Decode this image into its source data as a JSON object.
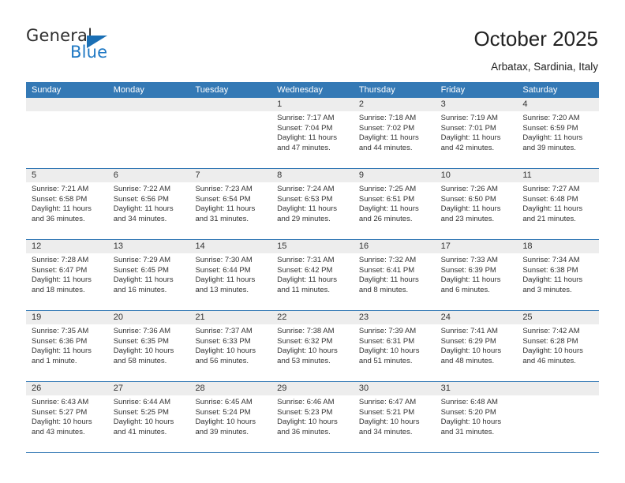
{
  "brand": {
    "name_top": "General",
    "name_bottom": "Blue",
    "triangle_color": "#1a6fb5",
    "blue_text_color": "#2079c4"
  },
  "header": {
    "title": "October 2025",
    "subtitle": "Arbatax, Sardinia, Italy"
  },
  "theme": {
    "header_blue": "#3479b5",
    "daynum_band": "#ededed",
    "cell_background": "#ffffff",
    "text": "#333333"
  },
  "calendar": {
    "weekday_headers": [
      "Sunday",
      "Monday",
      "Tuesday",
      "Wednesday",
      "Thursday",
      "Friday",
      "Saturday"
    ],
    "labels": {
      "sunrise": "Sunrise:",
      "sunset": "Sunset:",
      "daylight": "Daylight:"
    },
    "weeks": [
      [
        {
          "day": "",
          "empty": true
        },
        {
          "day": "",
          "empty": true
        },
        {
          "day": "",
          "empty": true
        },
        {
          "day": "1",
          "sunrise": "Sunrise: 7:17 AM",
          "sunset": "Sunset: 7:04 PM",
          "daylight_line1": "Daylight: 11 hours",
          "daylight_line2": "and 47 minutes."
        },
        {
          "day": "2",
          "sunrise": "Sunrise: 7:18 AM",
          "sunset": "Sunset: 7:02 PM",
          "daylight_line1": "Daylight: 11 hours",
          "daylight_line2": "and 44 minutes."
        },
        {
          "day": "3",
          "sunrise": "Sunrise: 7:19 AM",
          "sunset": "Sunset: 7:01 PM",
          "daylight_line1": "Daylight: 11 hours",
          "daylight_line2": "and 42 minutes."
        },
        {
          "day": "4",
          "sunrise": "Sunrise: 7:20 AM",
          "sunset": "Sunset: 6:59 PM",
          "daylight_line1": "Daylight: 11 hours",
          "daylight_line2": "and 39 minutes."
        }
      ],
      [
        {
          "day": "5",
          "sunrise": "Sunrise: 7:21 AM",
          "sunset": "Sunset: 6:58 PM",
          "daylight_line1": "Daylight: 11 hours",
          "daylight_line2": "and 36 minutes."
        },
        {
          "day": "6",
          "sunrise": "Sunrise: 7:22 AM",
          "sunset": "Sunset: 6:56 PM",
          "daylight_line1": "Daylight: 11 hours",
          "daylight_line2": "and 34 minutes."
        },
        {
          "day": "7",
          "sunrise": "Sunrise: 7:23 AM",
          "sunset": "Sunset: 6:54 PM",
          "daylight_line1": "Daylight: 11 hours",
          "daylight_line2": "and 31 minutes."
        },
        {
          "day": "8",
          "sunrise": "Sunrise: 7:24 AM",
          "sunset": "Sunset: 6:53 PM",
          "daylight_line1": "Daylight: 11 hours",
          "daylight_line2": "and 29 minutes."
        },
        {
          "day": "9",
          "sunrise": "Sunrise: 7:25 AM",
          "sunset": "Sunset: 6:51 PM",
          "daylight_line1": "Daylight: 11 hours",
          "daylight_line2": "and 26 minutes."
        },
        {
          "day": "10",
          "sunrise": "Sunrise: 7:26 AM",
          "sunset": "Sunset: 6:50 PM",
          "daylight_line1": "Daylight: 11 hours",
          "daylight_line2": "and 23 minutes."
        },
        {
          "day": "11",
          "sunrise": "Sunrise: 7:27 AM",
          "sunset": "Sunset: 6:48 PM",
          "daylight_line1": "Daylight: 11 hours",
          "daylight_line2": "and 21 minutes."
        }
      ],
      [
        {
          "day": "12",
          "sunrise": "Sunrise: 7:28 AM",
          "sunset": "Sunset: 6:47 PM",
          "daylight_line1": "Daylight: 11 hours",
          "daylight_line2": "and 18 minutes."
        },
        {
          "day": "13",
          "sunrise": "Sunrise: 7:29 AM",
          "sunset": "Sunset: 6:45 PM",
          "daylight_line1": "Daylight: 11 hours",
          "daylight_line2": "and 16 minutes."
        },
        {
          "day": "14",
          "sunrise": "Sunrise: 7:30 AM",
          "sunset": "Sunset: 6:44 PM",
          "daylight_line1": "Daylight: 11 hours",
          "daylight_line2": "and 13 minutes."
        },
        {
          "day": "15",
          "sunrise": "Sunrise: 7:31 AM",
          "sunset": "Sunset: 6:42 PM",
          "daylight_line1": "Daylight: 11 hours",
          "daylight_line2": "and 11 minutes."
        },
        {
          "day": "16",
          "sunrise": "Sunrise: 7:32 AM",
          "sunset": "Sunset: 6:41 PM",
          "daylight_line1": "Daylight: 11 hours",
          "daylight_line2": "and 8 minutes."
        },
        {
          "day": "17",
          "sunrise": "Sunrise: 7:33 AM",
          "sunset": "Sunset: 6:39 PM",
          "daylight_line1": "Daylight: 11 hours",
          "daylight_line2": "and 6 minutes."
        },
        {
          "day": "18",
          "sunrise": "Sunrise: 7:34 AM",
          "sunset": "Sunset: 6:38 PM",
          "daylight_line1": "Daylight: 11 hours",
          "daylight_line2": "and 3 minutes."
        }
      ],
      [
        {
          "day": "19",
          "sunrise": "Sunrise: 7:35 AM",
          "sunset": "Sunset: 6:36 PM",
          "daylight_line1": "Daylight: 11 hours",
          "daylight_line2": "and 1 minute."
        },
        {
          "day": "20",
          "sunrise": "Sunrise: 7:36 AM",
          "sunset": "Sunset: 6:35 PM",
          "daylight_line1": "Daylight: 10 hours",
          "daylight_line2": "and 58 minutes."
        },
        {
          "day": "21",
          "sunrise": "Sunrise: 7:37 AM",
          "sunset": "Sunset: 6:33 PM",
          "daylight_line1": "Daylight: 10 hours",
          "daylight_line2": "and 56 minutes."
        },
        {
          "day": "22",
          "sunrise": "Sunrise: 7:38 AM",
          "sunset": "Sunset: 6:32 PM",
          "daylight_line1": "Daylight: 10 hours",
          "daylight_line2": "and 53 minutes."
        },
        {
          "day": "23",
          "sunrise": "Sunrise: 7:39 AM",
          "sunset": "Sunset: 6:31 PM",
          "daylight_line1": "Daylight: 10 hours",
          "daylight_line2": "and 51 minutes."
        },
        {
          "day": "24",
          "sunrise": "Sunrise: 7:41 AM",
          "sunset": "Sunset: 6:29 PM",
          "daylight_line1": "Daylight: 10 hours",
          "daylight_line2": "and 48 minutes."
        },
        {
          "day": "25",
          "sunrise": "Sunrise: 7:42 AM",
          "sunset": "Sunset: 6:28 PM",
          "daylight_line1": "Daylight: 10 hours",
          "daylight_line2": "and 46 minutes."
        }
      ],
      [
        {
          "day": "26",
          "sunrise": "Sunrise: 6:43 AM",
          "sunset": "Sunset: 5:27 PM",
          "daylight_line1": "Daylight: 10 hours",
          "daylight_line2": "and 43 minutes."
        },
        {
          "day": "27",
          "sunrise": "Sunrise: 6:44 AM",
          "sunset": "Sunset: 5:25 PM",
          "daylight_line1": "Daylight: 10 hours",
          "daylight_line2": "and 41 minutes."
        },
        {
          "day": "28",
          "sunrise": "Sunrise: 6:45 AM",
          "sunset": "Sunset: 5:24 PM",
          "daylight_line1": "Daylight: 10 hours",
          "daylight_line2": "and 39 minutes."
        },
        {
          "day": "29",
          "sunrise": "Sunrise: 6:46 AM",
          "sunset": "Sunset: 5:23 PM",
          "daylight_line1": "Daylight: 10 hours",
          "daylight_line2": "and 36 minutes."
        },
        {
          "day": "30",
          "sunrise": "Sunrise: 6:47 AM",
          "sunset": "Sunset: 5:21 PM",
          "daylight_line1": "Daylight: 10 hours",
          "daylight_line2": "and 34 minutes."
        },
        {
          "day": "31",
          "sunrise": "Sunrise: 6:48 AM",
          "sunset": "Sunset: 5:20 PM",
          "daylight_line1": "Daylight: 10 hours",
          "daylight_line2": "and 31 minutes."
        },
        {
          "day": "",
          "empty": true
        }
      ]
    ]
  }
}
